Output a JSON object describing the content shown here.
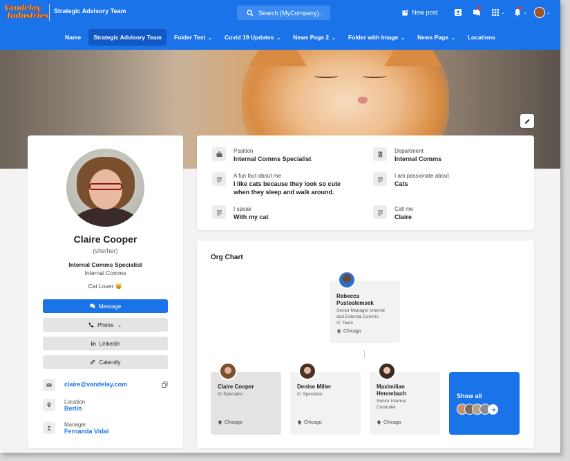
{
  "header": {
    "logo_line1": "Vandelay",
    "logo_line2": "Industries",
    "site_title": "Strategic Advisory Team",
    "search_placeholder": "Search (MyCompany)...",
    "new_post": "New post"
  },
  "nav": [
    {
      "label": "Name",
      "active": false,
      "dropdown": false
    },
    {
      "label": "Strategic Advisory Team",
      "active": true,
      "dropdown": false
    },
    {
      "label": "Folder Test",
      "active": false,
      "dropdown": true
    },
    {
      "label": "Covid 19 Updates",
      "active": false,
      "dropdown": true
    },
    {
      "label": "News Page 2",
      "active": false,
      "dropdown": true
    },
    {
      "label": "Folder with Image",
      "active": false,
      "dropdown": true
    },
    {
      "label": "News Page",
      "active": false,
      "dropdown": true
    },
    {
      "label": "Locations",
      "active": false,
      "dropdown": false
    }
  ],
  "profile": {
    "name": "Claire Cooper",
    "pronouns": "(she/her)",
    "title": "Internal Comms Specialist",
    "department": "Internal Comms",
    "tagline": "Cat Lover 😸",
    "buttons": {
      "message": "Message",
      "phone": "Phone",
      "linkedin": "Linkedin",
      "calendly": "Calendly"
    },
    "email": "claire@vandelay.com",
    "location_label": "Location",
    "location": "Berlin",
    "manager_label": "Manager",
    "manager": "Fernanda Vidal"
  },
  "info": {
    "position_label": "Position",
    "position": "Internal Comms Specialist",
    "department_label": "Department",
    "department": "Internal Comms",
    "funfact_label": "A fun fact about me",
    "funfact_line1": "I like cats because they look so cute",
    "funfact_line2": "when they sleep and walk around.",
    "passion_label": "I am passionate about",
    "passion": "Cats",
    "speak_label": "I speak",
    "speak": "With my cat",
    "callme_label": "Call me",
    "callme": "Claire"
  },
  "org": {
    "title": "Org Chart",
    "manager": {
      "name_line1": "Rebecca",
      "name_line2": "Pustoslemsek",
      "role_line1": "Senior Manager Internal",
      "role_line2": "and External Comms",
      "role_line3": "IC Team",
      "location": "Chicago"
    },
    "peers": [
      {
        "name_line1": "Claire Cooper",
        "name_line2": "",
        "role_line1": "IC Specialist",
        "role_line2": "",
        "location": "Chicago"
      },
      {
        "name_line1": "Denise Miller",
        "name_line2": "",
        "role_line1": "IC Specialist",
        "role_line2": "",
        "location": "Chicago"
      },
      {
        "name_line1": "Maximilian",
        "name_line2": "Hennebach",
        "role_line1": "Senior Internal",
        "role_line2": "Controller",
        "location": "Chicago"
      }
    ],
    "show_all": "Show all"
  },
  "colors": {
    "accent": "#1a73e8",
    "accent_dark": "#1158c7",
    "notification": "#e53935"
  }
}
